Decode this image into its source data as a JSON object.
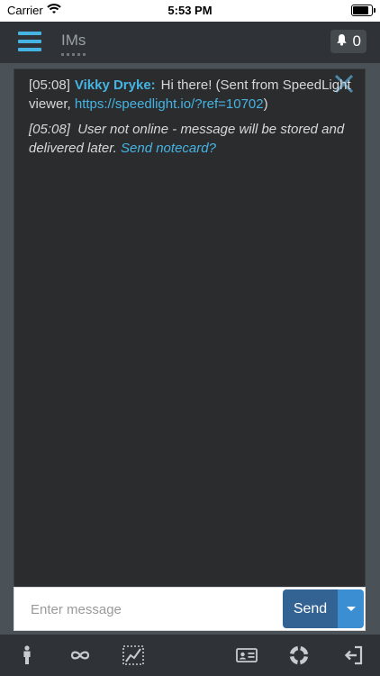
{
  "status_bar": {
    "carrier": "Carrier",
    "time": "5:53 PM",
    "battery_level": 0.95
  },
  "header": {
    "title": "IMs",
    "notification_count": "0",
    "menu_icon": "hamburger-menu-icon",
    "notification_icon": "bell-icon"
  },
  "messages": [
    {
      "time": "[05:08]",
      "author": "Vikky Dryke:",
      "text": "Hi there! (Sent from SpeedLight viewer, ",
      "link": "https://speedlight.io/?ref=10702",
      "suffix": ")"
    },
    {
      "time": "[05:08]",
      "text": "User not online - message will be stored and delivered later.",
      "link": "Send notecard?"
    }
  ],
  "input": {
    "placeholder": "Enter message",
    "value": ""
  },
  "send_button": {
    "label": "Send"
  },
  "bottom_nav": {
    "items": [
      "person-icon",
      "infinity-icon",
      "chart-icon",
      "id-card-icon",
      "lifebuoy-icon",
      "logout-icon"
    ]
  },
  "colors": {
    "accent": "#45b4e3",
    "send": "#336393",
    "send_dropdown": "#3a8ed1",
    "background": "#2b2c2e"
  }
}
